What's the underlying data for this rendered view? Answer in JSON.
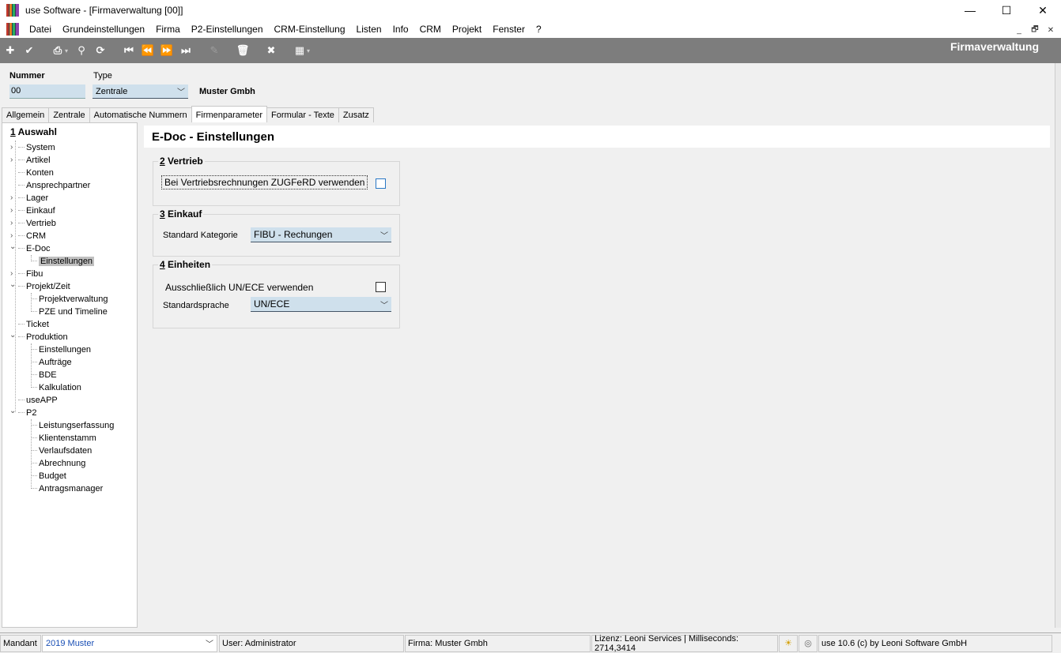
{
  "window": {
    "title": "use Software - [Firmaverwaltung [00]]",
    "min": "—",
    "max": "☐",
    "close": "✕"
  },
  "menu": [
    "Datei",
    "Grundeinstellungen",
    "Firma",
    "P2-Einstellungen",
    "CRM-Einstellung",
    "Listen",
    "Info",
    "CRM",
    "Projekt",
    "Fenster",
    "?"
  ],
  "mdi": {
    "min": "_",
    "restore": "🗗",
    "close": "✕"
  },
  "toolbar": {
    "title": "Firmaverwaltung"
  },
  "header": {
    "nummer_label": "Nummer",
    "nummer_value": "00",
    "type_label": "Type",
    "type_value": "Zentrale",
    "company_name": "Muster Gmbh"
  },
  "tabs": [
    "Allgemein",
    "Zentrale",
    "Automatische Nummern",
    "Firmenparameter",
    "Formular - Texte",
    "Zusatz"
  ],
  "active_tab": "Firmenparameter",
  "tree": {
    "title_num": "1",
    "title": "Auswahl",
    "items": [
      "System",
      "Artikel",
      "Konten",
      "Ansprechpartner",
      "Lager",
      "Einkauf",
      "Vertrieb",
      "CRM",
      "E-Doc",
      "Einstellungen",
      "Fibu",
      "Projekt/Zeit",
      "Projektverwaltung",
      "PZE und Timeline",
      "Ticket",
      "Produktion",
      "Einstellungen",
      "Aufträge",
      "BDE",
      "Kalkulation",
      "useAPP",
      "P2",
      "Leistungserfassung",
      "Klientenstamm",
      "Verlaufsdaten",
      "Abrechnung",
      "Budget",
      "Antragsmanager"
    ]
  },
  "main": {
    "header": "E-Doc - Einstellungen",
    "vertrieb": {
      "num": "2",
      "title": "Vertrieb",
      "zugferd_label": "Bei Vertriebsrechnungen ZUGFeRD verwenden",
      "zugferd_checked": false
    },
    "einkauf": {
      "num": "3",
      "title": "Einkauf",
      "kategorie_label": "Standard Kategorie",
      "kategorie_value": "FIBU - Rechungen"
    },
    "einheiten": {
      "num": "4",
      "title": "Einheiten",
      "unece_label": "Ausschließlich UN/ECE verwenden",
      "unece_checked": false,
      "sprache_label": "Standardsprache",
      "sprache_value": "UN/ECE"
    }
  },
  "status": {
    "mandant_label": "Mandant",
    "mandant_value": "2019 Muster",
    "user": "User: Administrator",
    "firma": "Firma: Muster Gmbh",
    "lizenz": "Lizenz: Leoni Services | Milliseconds: 2714,3414",
    "version": "use 10.6 (c) by Leoni Software GmbH"
  }
}
